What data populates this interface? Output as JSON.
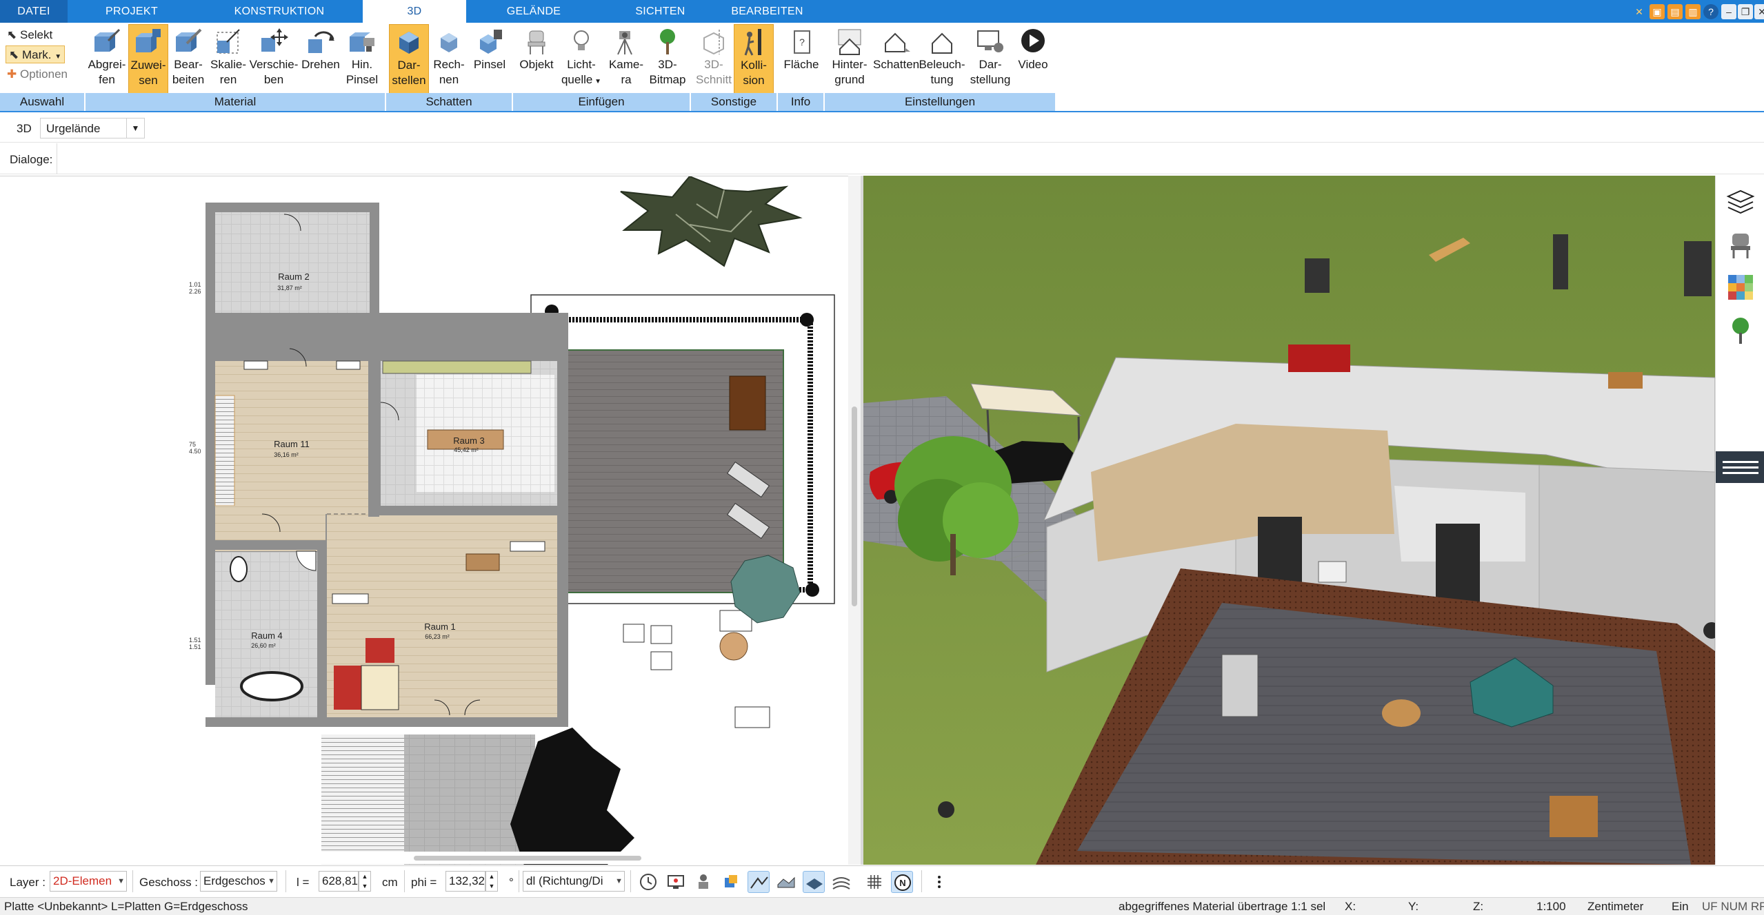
{
  "menu": {
    "tabs": [
      "DATEI",
      "PROJEKT",
      "KONSTRUKTION",
      "3D",
      "GELÄNDE",
      "SICHTEN",
      "BEARBEITEN"
    ],
    "active_tab": "3D"
  },
  "ribbon": {
    "auswahl": {
      "selekt": "Selekt",
      "mark": "Mark.",
      "optionen": "Optionen",
      "group": "Auswahl"
    },
    "material": {
      "group": "Material",
      "buttons": [
        {
          "l1": "Abgrei-",
          "l2": "fen"
        },
        {
          "l1": "Zuwei-",
          "l2": "sen"
        },
        {
          "l1": "Bear-",
          "l2": "beiten"
        },
        {
          "l1": "Skalie-",
          "l2": "ren"
        },
        {
          "l1": "Verschie-",
          "l2": "ben"
        },
        {
          "l1": "Drehen",
          "l2": ""
        },
        {
          "l1": "Hin.",
          "l2": "Pinsel"
        }
      ]
    },
    "schatten": {
      "group": "Schatten",
      "buttons": [
        {
          "l1": "Dar-",
          "l2": "stellen"
        },
        {
          "l1": "Rech-",
          "l2": "nen"
        },
        {
          "l1": "Pinsel",
          "l2": ""
        }
      ]
    },
    "einfuegen": {
      "group": "Einfügen",
      "buttons": [
        {
          "l1": "Objekt",
          "l2": ""
        },
        {
          "l1": "Licht-",
          "l2": "quelle"
        },
        {
          "l1": "Kame-",
          "l2": "ra"
        },
        {
          "l1": "3D-",
          "l2": "Bitmap"
        }
      ]
    },
    "sonstige": {
      "group": "Sonstige",
      "buttons": [
        {
          "l1": "3D-",
          "l2": "Schnitt"
        },
        {
          "l1": "Kolli-",
          "l2": "sion"
        }
      ]
    },
    "info": {
      "group": "Info",
      "buttons": [
        {
          "l1": "Fläche",
          "l2": ""
        }
      ]
    },
    "einstellungen": {
      "group": "Einstellungen",
      "buttons": [
        {
          "l1": "Hinter-",
          "l2": "grund"
        },
        {
          "l1": "Schatten",
          "l2": ""
        },
        {
          "l1": "Beleuch-",
          "l2": "tung"
        },
        {
          "l1": "Dar-",
          "l2": "stellung"
        },
        {
          "l1": "Video",
          "l2": ""
        }
      ]
    }
  },
  "subbar": {
    "label": "3D",
    "terrain_value": "Urgelände"
  },
  "dialoge": {
    "label": "Dialoge:"
  },
  "plan": {
    "rooms": [
      {
        "name": "Raum 2",
        "area": "31,87 m²"
      },
      {
        "name": "Raum 11",
        "area": "36,16 m²"
      },
      {
        "name": "Raum 3",
        "area": "45,42 m²"
      },
      {
        "name": "Raum 1",
        "area": "66,23 m²"
      },
      {
        "name": "Raum 4",
        "area": "26,60 m²"
      }
    ],
    "dims": [
      "1.01",
      "2.26",
      "75",
      "4.50",
      "1.51",
      "1.51"
    ]
  },
  "bottombar": {
    "layer_label": "Layer :",
    "layer_value": "2D-Elemen",
    "geschoss_label": "Geschoss :",
    "geschoss_value": "Erdgeschos",
    "l_label": "l =",
    "l_value": "628,81",
    "l_unit": "cm",
    "phi_label": "phi =",
    "phi_value": "132,32",
    "phi_unit": "°",
    "dl_value": "dl (Richtung/Di"
  },
  "statusbar": {
    "left": "Platte <Unbekannt> L=Platten G=Erdgeschoss",
    "message": "abgegriffenes Material übertrage 1:1 sel",
    "x": "X:",
    "y": "Y:",
    "z": "Z:",
    "scale": "1:100",
    "unit": "Zentimeter",
    "mode": "Ein",
    "flags": "UF NUM RF"
  }
}
